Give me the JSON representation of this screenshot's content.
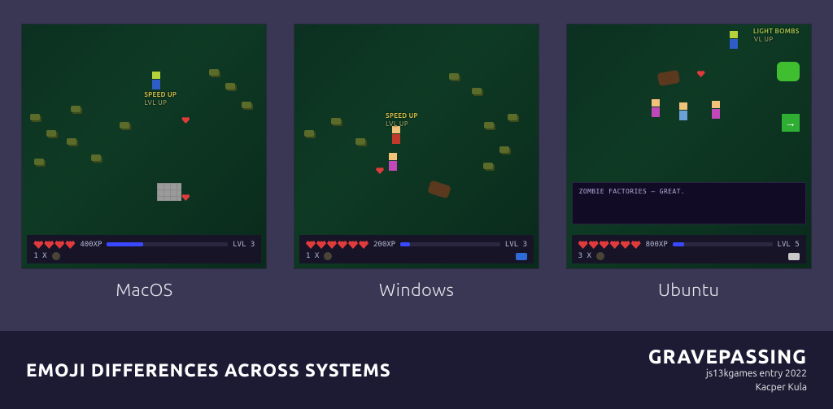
{
  "shots": [
    {
      "os": "MacOS",
      "messages": [
        "SPEED UP",
        "LVL UP"
      ],
      "hud": {
        "hearts": 4,
        "xp": "400XP",
        "xp_fill_pct": 30,
        "level": "LVL 3",
        "inventory": "1 X"
      }
    },
    {
      "os": "Windows",
      "messages": [
        "SPEED UP",
        "LVL UP"
      ],
      "hud": {
        "hearts": 6,
        "xp": "200XP",
        "xp_fill_pct": 10,
        "level": "LVL 3",
        "inventory": "1 X"
      }
    },
    {
      "os": "Ubuntu",
      "messages": [
        "LIGHT BOMBS",
        "VL UP"
      ],
      "dialog": "ZOMBIE FACTORIES – GREAT.",
      "hud": {
        "hearts": 6,
        "xp": "800XP",
        "xp_fill_pct": 12,
        "level": "LVL 5",
        "inventory": "3 X"
      }
    }
  ],
  "footer": {
    "title": "Emoji Differences Across Systems",
    "brand": "GRAVEPASSING",
    "sub1": "js13kgames entry 2022",
    "sub2": "Kacper Kula"
  }
}
